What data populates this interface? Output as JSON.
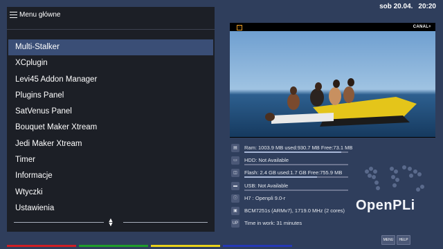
{
  "menu": {
    "title": "Menu główne",
    "items": [
      {
        "label": "Multi-Stalker",
        "selected": true
      },
      {
        "label": "XCplugin"
      },
      {
        "label": "Levi45 Addon Manager"
      },
      {
        "label": "Plugins Panel"
      },
      {
        "label": "SatVenus Panel"
      },
      {
        "label": "Bouquet Maker Xtream"
      },
      {
        "label": "Jedi Maker Xtream"
      },
      {
        "label": "Timer"
      },
      {
        "label": "Informacje"
      },
      {
        "label": "Wtyczki"
      },
      {
        "label": "Ustawienia"
      }
    ]
  },
  "clock": {
    "date": "sob 20.04.",
    "time": "20:20"
  },
  "video": {
    "channel_logo": "CANAL+"
  },
  "info": [
    {
      "icon": "memory-icon",
      "text": "Ram: 1003.9 MB used:930.7 MB Free:73.1 MB",
      "bar_fraction": 0.93
    },
    {
      "icon": "hdd-icon",
      "text": "HDD: Not Available",
      "bar_fraction": 0.0
    },
    {
      "icon": "flash-icon",
      "text": "Flash: 2.4 GB used:1.7 GB Free:755.9 MB",
      "bar_fraction": 0.7
    },
    {
      "icon": "usb-icon",
      "text": "USB: Not Available",
      "bar_fraction": 0.0
    },
    {
      "icon": "info-icon",
      "text": "H7 : Openpli 9.0-r",
      "bar_fraction": null
    },
    {
      "icon": "cpu-icon",
      "text": "BCM7251s (ARMv7), 1719.0 MHz (2 cores)",
      "bar_fraction": null
    },
    {
      "icon": "uptime-icon",
      "label": "UP",
      "text": "Time in work: 31 minutes",
      "bar_fraction": null
    }
  ],
  "logo": {
    "text": "OpenPLi"
  },
  "buttons": {
    "menu": "MENU",
    "help": "HELP"
  },
  "colors": {
    "red": "#d01e24",
    "green": "#1f9e2a",
    "yellow": "#e8d21a",
    "blue": "#2438b8",
    "selection": "#3a4e76",
    "background": "#2f3e5c"
  }
}
